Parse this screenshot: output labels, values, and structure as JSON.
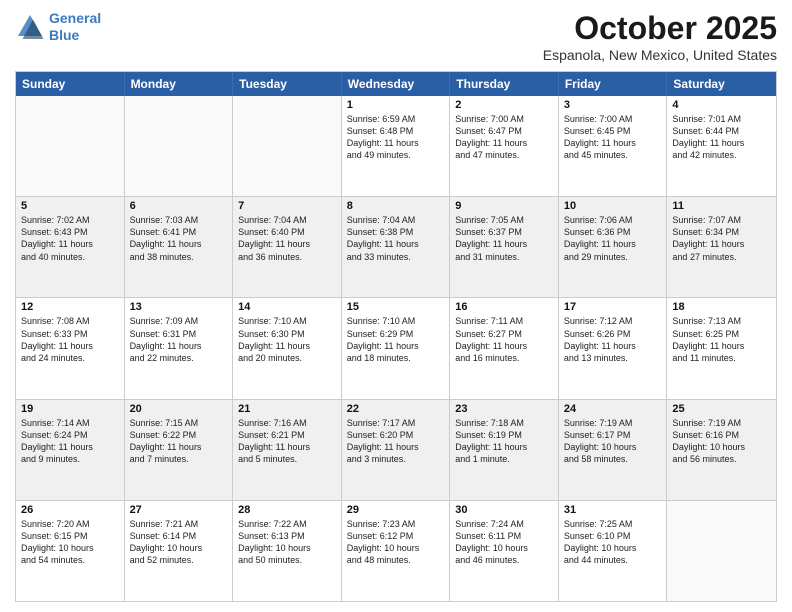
{
  "logo": {
    "line1": "General",
    "line2": "Blue"
  },
  "title": "October 2025",
  "location": "Espanola, New Mexico, United States",
  "days_of_week": [
    "Sunday",
    "Monday",
    "Tuesday",
    "Wednesday",
    "Thursday",
    "Friday",
    "Saturday"
  ],
  "weeks": [
    [
      {
        "day": "",
        "empty": true,
        "content": ""
      },
      {
        "day": "",
        "empty": true,
        "content": ""
      },
      {
        "day": "",
        "empty": true,
        "content": ""
      },
      {
        "day": "1",
        "content": "Sunrise: 6:59 AM\nSunset: 6:48 PM\nDaylight: 11 hours\nand 49 minutes."
      },
      {
        "day": "2",
        "content": "Sunrise: 7:00 AM\nSunset: 6:47 PM\nDaylight: 11 hours\nand 47 minutes."
      },
      {
        "day": "3",
        "content": "Sunrise: 7:00 AM\nSunset: 6:45 PM\nDaylight: 11 hours\nand 45 minutes."
      },
      {
        "day": "4",
        "content": "Sunrise: 7:01 AM\nSunset: 6:44 PM\nDaylight: 11 hours\nand 42 minutes."
      }
    ],
    [
      {
        "day": "5",
        "content": "Sunrise: 7:02 AM\nSunset: 6:43 PM\nDaylight: 11 hours\nand 40 minutes."
      },
      {
        "day": "6",
        "content": "Sunrise: 7:03 AM\nSunset: 6:41 PM\nDaylight: 11 hours\nand 38 minutes."
      },
      {
        "day": "7",
        "content": "Sunrise: 7:04 AM\nSunset: 6:40 PM\nDaylight: 11 hours\nand 36 minutes."
      },
      {
        "day": "8",
        "content": "Sunrise: 7:04 AM\nSunset: 6:38 PM\nDaylight: 11 hours\nand 33 minutes."
      },
      {
        "day": "9",
        "content": "Sunrise: 7:05 AM\nSunset: 6:37 PM\nDaylight: 11 hours\nand 31 minutes."
      },
      {
        "day": "10",
        "content": "Sunrise: 7:06 AM\nSunset: 6:36 PM\nDaylight: 11 hours\nand 29 minutes."
      },
      {
        "day": "11",
        "content": "Sunrise: 7:07 AM\nSunset: 6:34 PM\nDaylight: 11 hours\nand 27 minutes."
      }
    ],
    [
      {
        "day": "12",
        "content": "Sunrise: 7:08 AM\nSunset: 6:33 PM\nDaylight: 11 hours\nand 24 minutes."
      },
      {
        "day": "13",
        "content": "Sunrise: 7:09 AM\nSunset: 6:31 PM\nDaylight: 11 hours\nand 22 minutes."
      },
      {
        "day": "14",
        "content": "Sunrise: 7:10 AM\nSunset: 6:30 PM\nDaylight: 11 hours\nand 20 minutes."
      },
      {
        "day": "15",
        "content": "Sunrise: 7:10 AM\nSunset: 6:29 PM\nDaylight: 11 hours\nand 18 minutes."
      },
      {
        "day": "16",
        "content": "Sunrise: 7:11 AM\nSunset: 6:27 PM\nDaylight: 11 hours\nand 16 minutes."
      },
      {
        "day": "17",
        "content": "Sunrise: 7:12 AM\nSunset: 6:26 PM\nDaylight: 11 hours\nand 13 minutes."
      },
      {
        "day": "18",
        "content": "Sunrise: 7:13 AM\nSunset: 6:25 PM\nDaylight: 11 hours\nand 11 minutes."
      }
    ],
    [
      {
        "day": "19",
        "content": "Sunrise: 7:14 AM\nSunset: 6:24 PM\nDaylight: 11 hours\nand 9 minutes."
      },
      {
        "day": "20",
        "content": "Sunrise: 7:15 AM\nSunset: 6:22 PM\nDaylight: 11 hours\nand 7 minutes."
      },
      {
        "day": "21",
        "content": "Sunrise: 7:16 AM\nSunset: 6:21 PM\nDaylight: 11 hours\nand 5 minutes."
      },
      {
        "day": "22",
        "content": "Sunrise: 7:17 AM\nSunset: 6:20 PM\nDaylight: 11 hours\nand 3 minutes."
      },
      {
        "day": "23",
        "content": "Sunrise: 7:18 AM\nSunset: 6:19 PM\nDaylight: 11 hours\nand 1 minute."
      },
      {
        "day": "24",
        "content": "Sunrise: 7:19 AM\nSunset: 6:17 PM\nDaylight: 10 hours\nand 58 minutes."
      },
      {
        "day": "25",
        "content": "Sunrise: 7:19 AM\nSunset: 6:16 PM\nDaylight: 10 hours\nand 56 minutes."
      }
    ],
    [
      {
        "day": "26",
        "content": "Sunrise: 7:20 AM\nSunset: 6:15 PM\nDaylight: 10 hours\nand 54 minutes."
      },
      {
        "day": "27",
        "content": "Sunrise: 7:21 AM\nSunset: 6:14 PM\nDaylight: 10 hours\nand 52 minutes."
      },
      {
        "day": "28",
        "content": "Sunrise: 7:22 AM\nSunset: 6:13 PM\nDaylight: 10 hours\nand 50 minutes."
      },
      {
        "day": "29",
        "content": "Sunrise: 7:23 AM\nSunset: 6:12 PM\nDaylight: 10 hours\nand 48 minutes."
      },
      {
        "day": "30",
        "content": "Sunrise: 7:24 AM\nSunset: 6:11 PM\nDaylight: 10 hours\nand 46 minutes."
      },
      {
        "day": "31",
        "content": "Sunrise: 7:25 AM\nSunset: 6:10 PM\nDaylight: 10 hours\nand 44 minutes."
      },
      {
        "day": "",
        "empty": true,
        "content": ""
      }
    ]
  ]
}
